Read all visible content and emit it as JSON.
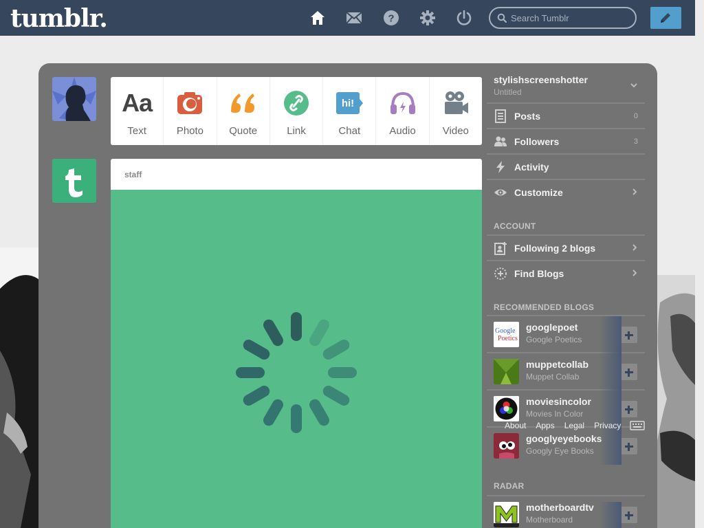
{
  "header": {
    "logo": "tumblr.",
    "nav": [
      "home-icon",
      "mail-icon",
      "help-icon",
      "settings-icon",
      "power-icon"
    ],
    "search_placeholder": "Search Tumblr",
    "compose_icon": "pencil-icon",
    "bg_color": "#36465d"
  },
  "post_types": [
    {
      "label": "Text",
      "icon": "text-icon",
      "color": "#444444"
    },
    {
      "label": "Photo",
      "icon": "camera-icon",
      "color": "#d95e40"
    },
    {
      "label": "Quote",
      "icon": "quote-icon",
      "color": "#f2992e"
    },
    {
      "label": "Link",
      "icon": "link-icon",
      "color": "#56bc8a"
    },
    {
      "label": "Chat",
      "icon": "chat-icon",
      "color": "#529ecc"
    },
    {
      "label": "Audio",
      "icon": "headphones-icon",
      "color": "#a77dc2"
    },
    {
      "label": "Video",
      "icon": "video-camera-icon",
      "color": "#748089"
    }
  ],
  "text_glyph": "Aa",
  "chat_glyph": "hi!",
  "post": {
    "author": "staff",
    "body_color": "#56bc8a"
  },
  "sidebar": {
    "blog_name": "stylishscreenshotter",
    "blog_title": "Untitled",
    "items": [
      {
        "label": "Posts",
        "count": "0",
        "icon": "document-icon"
      },
      {
        "label": "Followers",
        "count": "3",
        "icon": "followers-icon"
      },
      {
        "label": "Activity",
        "count": "",
        "icon": "lightning-icon"
      },
      {
        "label": "Customize",
        "count": "",
        "icon": "eye-icon"
      }
    ],
    "account_title": "ACCOUNT",
    "account_items": [
      {
        "label": "Following 2 blogs",
        "icon": "following-icon"
      },
      {
        "label": "Find Blogs",
        "icon": "compass-icon"
      }
    ],
    "recommended_title": "RECOMMENDED BLOGS",
    "recommended": [
      {
        "name": "googlepoet",
        "title": "Google Poetics"
      },
      {
        "name": "muppetcollab",
        "title": "Muppet Collab"
      },
      {
        "name": "moviesincolor",
        "title": "Movies In Color"
      },
      {
        "name": "googlyeyebooks",
        "title": "Googly Eye Books"
      }
    ],
    "radar_title": "RADAR",
    "radar": [
      {
        "name": "motherboardtv",
        "title": "Motherboard"
      }
    ]
  },
  "footer_links": [
    "About",
    "Apps",
    "Legal",
    "Privacy"
  ]
}
